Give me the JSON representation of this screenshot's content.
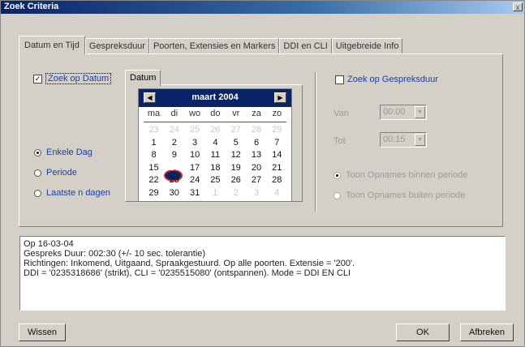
{
  "window": {
    "title": "Zoek Criteria",
    "close_label": "x"
  },
  "tabs": [
    {
      "label": "Datum en Tijd",
      "active": true
    },
    {
      "label": "Gespreksduur"
    },
    {
      "label": "Poorten, Extensies en Markers"
    },
    {
      "label": "DDI en CLI"
    },
    {
      "label": "Uitgebreide Info"
    }
  ],
  "date_search": {
    "label": "Zoek op Datum",
    "checked": true,
    "check_mark": "✓"
  },
  "date_mode": {
    "options": [
      {
        "label": "Enkele Dag",
        "selected": true
      },
      {
        "label": "Periode",
        "selected": false
      },
      {
        "label": "Laatste n dagen",
        "selected": false
      }
    ]
  },
  "calendar": {
    "tab_label": "Datum",
    "month_label": "maart 2004",
    "prev_icon": "◀",
    "next_icon": "▶",
    "weekdays": [
      "ma",
      "di",
      "wo",
      "do",
      "vr",
      "za",
      "zo"
    ],
    "weeks": [
      [
        "23",
        "24",
        "25",
        "26",
        "27",
        "28",
        "29"
      ],
      [
        "1",
        "2",
        "3",
        "4",
        "5",
        "6",
        "7"
      ],
      [
        "8",
        "9",
        "10",
        "11",
        "12",
        "13",
        "14"
      ],
      [
        "15",
        "16",
        "17",
        "18",
        "19",
        "20",
        "21"
      ],
      [
        "22",
        "23",
        "24",
        "25",
        "26",
        "27",
        "28"
      ],
      [
        "29",
        "30",
        "31",
        "1",
        "2",
        "3",
        "4"
      ]
    ],
    "selected_day": "16"
  },
  "duration_search": {
    "label": "Zoek op Gespreksduur",
    "checked": false
  },
  "duration": {
    "from_label": "Van",
    "from_value": "00:00",
    "to_label": "Tot",
    "to_value": "00:15",
    "options": [
      {
        "label": "Toon Opnames binnen periode",
        "selected": true
      },
      {
        "label": "Toon Opnames buiten periode",
        "selected": false
      }
    ]
  },
  "summary": {
    "lines": [
      "Op 16-03-04",
      "Gespreks Duur: 002:30 (+/- 10 sec. tolerantie)",
      "Richtingen: Inkomend, Uitgaand, Spraakgestuurd.  Op alle poorten.  Extensie = '200'.",
      "DDI = '0235318686' (strikt), CLI = '0235515080' (ontspannen).  Mode = DDI EN CLI"
    ]
  },
  "buttons": {
    "clear": "Wissen",
    "ok": "OK",
    "cancel": "Afbreken"
  }
}
